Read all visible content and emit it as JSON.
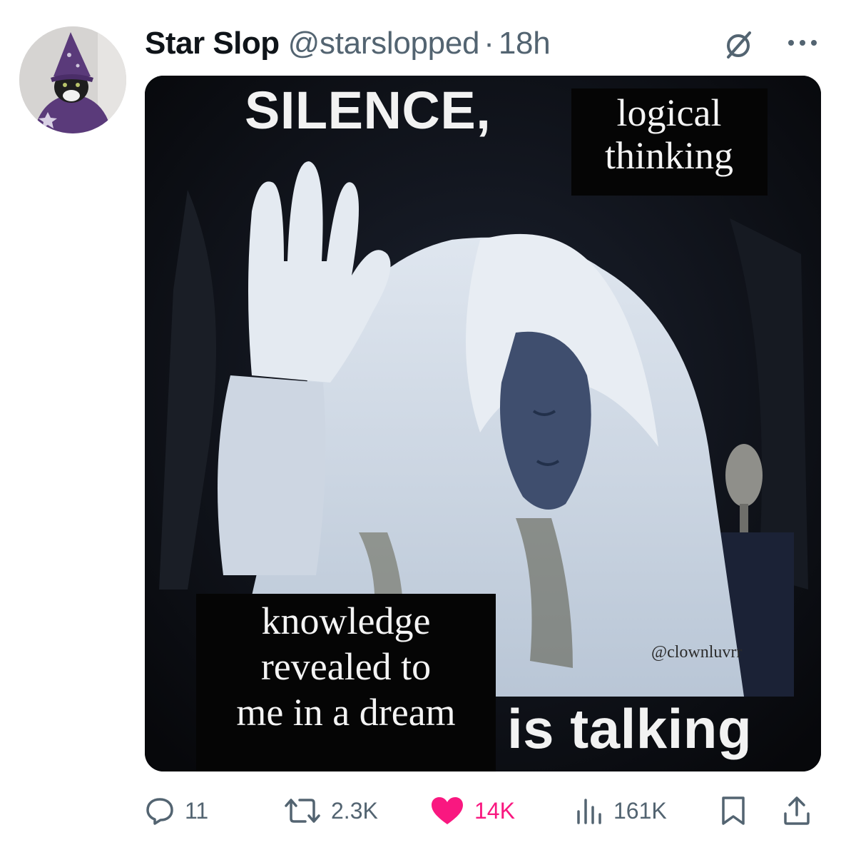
{
  "tweet": {
    "author": {
      "display_name": "Star Slop",
      "handle": "@starslopped",
      "separator": "·",
      "time": "18h",
      "avatar_icon": "cat-wizard-avatar"
    },
    "header_icons": [
      "grok-icon",
      "more-icon"
    ],
    "media": {
      "captions": {
        "top_big": "SILENCE,",
        "top_small_line1": "logical",
        "top_small_line2": "thinking",
        "bottom_small_line1": "knowledge",
        "bottom_small_line2": "revealed to",
        "bottom_small_line3": "me in a dream",
        "bottom_big": "is talking",
        "watermark": "@clownluvrr"
      }
    },
    "actions": {
      "replies": {
        "icon": "reply-icon",
        "count": "11"
      },
      "reposts": {
        "icon": "repost-icon",
        "count": "2.3K"
      },
      "likes": {
        "icon": "heart-icon",
        "count": "14K",
        "liked": true
      },
      "views": {
        "icon": "views-icon",
        "count": "161K"
      },
      "bookmark": {
        "icon": "bookmark-icon"
      },
      "share": {
        "icon": "share-icon"
      }
    },
    "colors": {
      "text_primary": "#0f1419",
      "text_secondary": "#536471",
      "like_pink": "#f91880"
    }
  }
}
